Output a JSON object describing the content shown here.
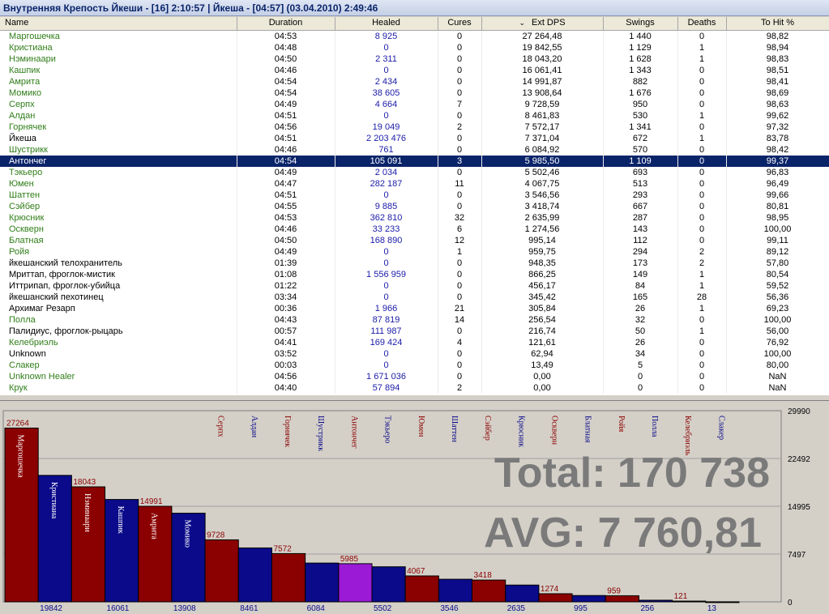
{
  "window": {
    "title": "Внутренняя Крепость Йкеши - [16] 2:10:57 | Йкеша - [04:57] (03.04.2010) 2:49:46"
  },
  "colors": {
    "green_name": "#2f7d18",
    "black_name": "#000000",
    "healed_blue": "#1a1aa8",
    "selected_row": "#0a246a",
    "bar_red": "#8b0000",
    "bar_blue": "#0a0a8a",
    "bar_highlight": "#9a1ad6",
    "overlay_text": "#7a7a7a"
  },
  "table": {
    "headers": [
      "Name",
      "Duration",
      "Healed",
      "Cures",
      "Ext DPS",
      "Swings",
      "Deaths",
      "To Hit %"
    ],
    "sort_indicator": "⌄",
    "rows": [
      {
        "name": "Маргошечка",
        "color": "green",
        "duration": "04:53",
        "healed": "8 925",
        "cures": "0",
        "dps": "27 264,48",
        "swings": "1 440",
        "deaths": "0",
        "tohit": "98,82"
      },
      {
        "name": "Кристиана",
        "color": "green",
        "duration": "04:48",
        "healed": "0",
        "cures": "0",
        "dps": "19 842,55",
        "swings": "1 129",
        "deaths": "1",
        "tohit": "98,94"
      },
      {
        "name": "Нэминаари",
        "color": "green",
        "duration": "04:50",
        "healed": "2 311",
        "cures": "0",
        "dps": "18 043,20",
        "swings": "1 628",
        "deaths": "1",
        "tohit": "98,83"
      },
      {
        "name": "Кашпик",
        "color": "green",
        "duration": "04:46",
        "healed": "0",
        "cures": "0",
        "dps": "16 061,41",
        "swings": "1 343",
        "deaths": "0",
        "tohit": "98,51"
      },
      {
        "name": "Амрита",
        "color": "green",
        "duration": "04:54",
        "healed": "2 434",
        "cures": "0",
        "dps": "14 991,87",
        "swings": "882",
        "deaths": "0",
        "tohit": "98,41"
      },
      {
        "name": "Момико",
        "color": "green",
        "duration": "04:54",
        "healed": "38 605",
        "cures": "0",
        "dps": "13 908,64",
        "swings": "1 676",
        "deaths": "0",
        "tohit": "98,69"
      },
      {
        "name": "Серпх",
        "color": "green",
        "duration": "04:49",
        "healed": "4 664",
        "cures": "7",
        "dps": "9 728,59",
        "swings": "950",
        "deaths": "0",
        "tohit": "98,63"
      },
      {
        "name": "Алдан",
        "color": "green",
        "duration": "04:51",
        "healed": "0",
        "cures": "0",
        "dps": "8 461,83",
        "swings": "530",
        "deaths": "1",
        "tohit": "99,62"
      },
      {
        "name": "Горнячек",
        "color": "green",
        "duration": "04:56",
        "healed": "19 049",
        "cures": "2",
        "dps": "7 572,17",
        "swings": "1 341",
        "deaths": "0",
        "tohit": "97,32"
      },
      {
        "name": "Йкеша",
        "color": "black",
        "duration": "04:51",
        "healed": "2 203 476",
        "cures": "0",
        "dps": "7 371,04",
        "swings": "672",
        "deaths": "1",
        "tohit": "83,78"
      },
      {
        "name": "Шустрикк",
        "color": "green",
        "duration": "04:46",
        "healed": "761",
        "cures": "0",
        "dps": "6 084,92",
        "swings": "570",
        "deaths": "0",
        "tohit": "98,42"
      },
      {
        "name": "Антончег",
        "color": "green",
        "duration": "04:54",
        "healed": "105 091",
        "cures": "3",
        "dps": "5 985,50",
        "swings": "1 109",
        "deaths": "0",
        "tohit": "99,37",
        "selected": true
      },
      {
        "name": "Тэкьеро",
        "color": "green",
        "duration": "04:49",
        "healed": "2 034",
        "cures": "0",
        "dps": "5 502,46",
        "swings": "693",
        "deaths": "0",
        "tohit": "96,83"
      },
      {
        "name": "Юмен",
        "color": "green",
        "duration": "04:47",
        "healed": "282 187",
        "cures": "11",
        "dps": "4 067,75",
        "swings": "513",
        "deaths": "0",
        "tohit": "96,49"
      },
      {
        "name": "Шаттен",
        "color": "green",
        "duration": "04:51",
        "healed": "0",
        "cures": "0",
        "dps": "3 546,56",
        "swings": "293",
        "deaths": "0",
        "tohit": "99,66"
      },
      {
        "name": "Сэйбер",
        "color": "green",
        "duration": "04:55",
        "healed": "9 885",
        "cures": "0",
        "dps": "3 418,74",
        "swings": "667",
        "deaths": "0",
        "tohit": "80,81"
      },
      {
        "name": "Крюсник",
        "color": "green",
        "duration": "04:53",
        "healed": "362 810",
        "cures": "32",
        "dps": "2 635,99",
        "swings": "287",
        "deaths": "0",
        "tohit": "98,95"
      },
      {
        "name": "Оскверн",
        "color": "green",
        "duration": "04:46",
        "healed": "33 233",
        "cures": "6",
        "dps": "1 274,56",
        "swings": "143",
        "deaths": "0",
        "tohit": "100,00"
      },
      {
        "name": "Блатная",
        "color": "green",
        "duration": "04:50",
        "healed": "168 890",
        "cures": "12",
        "dps": "995,14",
        "swings": "112",
        "deaths": "0",
        "tohit": "99,11"
      },
      {
        "name": "Ройя",
        "color": "green",
        "duration": "04:49",
        "healed": "0",
        "cures": "1",
        "dps": "959,75",
        "swings": "294",
        "deaths": "2",
        "tohit": "89,12"
      },
      {
        "name": "йкешанский телохранитель",
        "color": "black",
        "duration": "01:39",
        "healed": "0",
        "cures": "0",
        "dps": "948,35",
        "swings": "173",
        "deaths": "2",
        "tohit": "57,80"
      },
      {
        "name": "Мриттап, фроглок-мистик",
        "color": "black",
        "duration": "01:08",
        "healed": "1 556 959",
        "cures": "0",
        "dps": "866,25",
        "swings": "149",
        "deaths": "1",
        "tohit": "80,54"
      },
      {
        "name": "Иттрипап, фроглок-убийца",
        "color": "black",
        "duration": "01:22",
        "healed": "0",
        "cures": "0",
        "dps": "456,17",
        "swings": "84",
        "deaths": "1",
        "tohit": "59,52"
      },
      {
        "name": "йкешанский пехотинец",
        "color": "black",
        "duration": "03:34",
        "healed": "0",
        "cures": "0",
        "dps": "345,42",
        "swings": "165",
        "deaths": "28",
        "tohit": "56,36"
      },
      {
        "name": "Архимаг Резарп",
        "color": "black",
        "duration": "00:36",
        "healed": "1 966",
        "cures": "21",
        "dps": "305,84",
        "swings": "26",
        "deaths": "1",
        "tohit": "69,23"
      },
      {
        "name": "Полла",
        "color": "green",
        "duration": "04:43",
        "healed": "87 819",
        "cures": "14",
        "dps": "256,54",
        "swings": "32",
        "deaths": "0",
        "tohit": "100,00"
      },
      {
        "name": "Палидиус, фроглок-рыцарь",
        "color": "black",
        "duration": "00:57",
        "healed": "111 987",
        "cures": "0",
        "dps": "216,74",
        "swings": "50",
        "deaths": "1",
        "tohit": "56,00"
      },
      {
        "name": "Келебриэль",
        "color": "green",
        "duration": "04:41",
        "healed": "169 424",
        "cures": "4",
        "dps": "121,61",
        "swings": "26",
        "deaths": "0",
        "tohit": "76,92"
      },
      {
        "name": "Unknown",
        "color": "black",
        "duration": "03:52",
        "healed": "0",
        "cures": "0",
        "dps": "62,94",
        "swings": "34",
        "deaths": "0",
        "tohit": "100,00"
      },
      {
        "name": "Слакер",
        "color": "green",
        "duration": "00:03",
        "healed": "0",
        "cures": "0",
        "dps": "13,49",
        "swings": "5",
        "deaths": "0",
        "tohit": "80,00"
      },
      {
        "name": "Unknown Healer",
        "color": "green",
        "duration": "04:56",
        "healed": "1 671 036",
        "cures": "0",
        "dps": "0,00",
        "swings": "0",
        "deaths": "0",
        "tohit": "NaN"
      },
      {
        "name": "Крук",
        "color": "green",
        "duration": "04:40",
        "healed": "57 894",
        "cures": "2",
        "dps": "0,00",
        "swings": "0",
        "deaths": "0",
        "tohit": "NaN"
      }
    ]
  },
  "overlay": {
    "total": "Total: 170 738",
    "avg": "AVG: 7 760,81"
  },
  "chart_data": {
    "type": "bar",
    "ylim": [
      0,
      29990
    ],
    "y_ticks": [
      "29990",
      "22492",
      "14995",
      "7497",
      "0"
    ],
    "highlight": "Антончег",
    "categories": [
      "Маргошечка",
      "Кристиана",
      "Нэминаари",
      "Кашпик",
      "Амрита",
      "Момико",
      "Серпх",
      "Алдан",
      "Горнячек",
      "Шустрикк",
      "Антончег",
      "Тэкьеро",
      "Юмен",
      "Шаттен",
      "Сэйбер",
      "Крюсник",
      "Оскверн",
      "Блатная",
      "Ройя",
      "Полла",
      "Келебриэль",
      "Слакер"
    ],
    "values": [
      27264,
      19842,
      18043,
      16061,
      14991,
      13908,
      9728,
      8461,
      7572,
      6084,
      5985,
      5502,
      4067,
      3546,
      3418,
      2635,
      1274,
      995,
      959,
      256,
      121,
      13
    ],
    "value_labels": [
      "27264",
      "19842",
      "18043",
      "16061",
      "14991",
      "13908",
      "9728",
      "8461",
      "7572",
      "6084",
      "5985",
      "5502",
      "4067",
      "3546",
      "3418",
      "2635",
      "1274",
      "995",
      "959",
      "256",
      "121",
      "13"
    ]
  }
}
